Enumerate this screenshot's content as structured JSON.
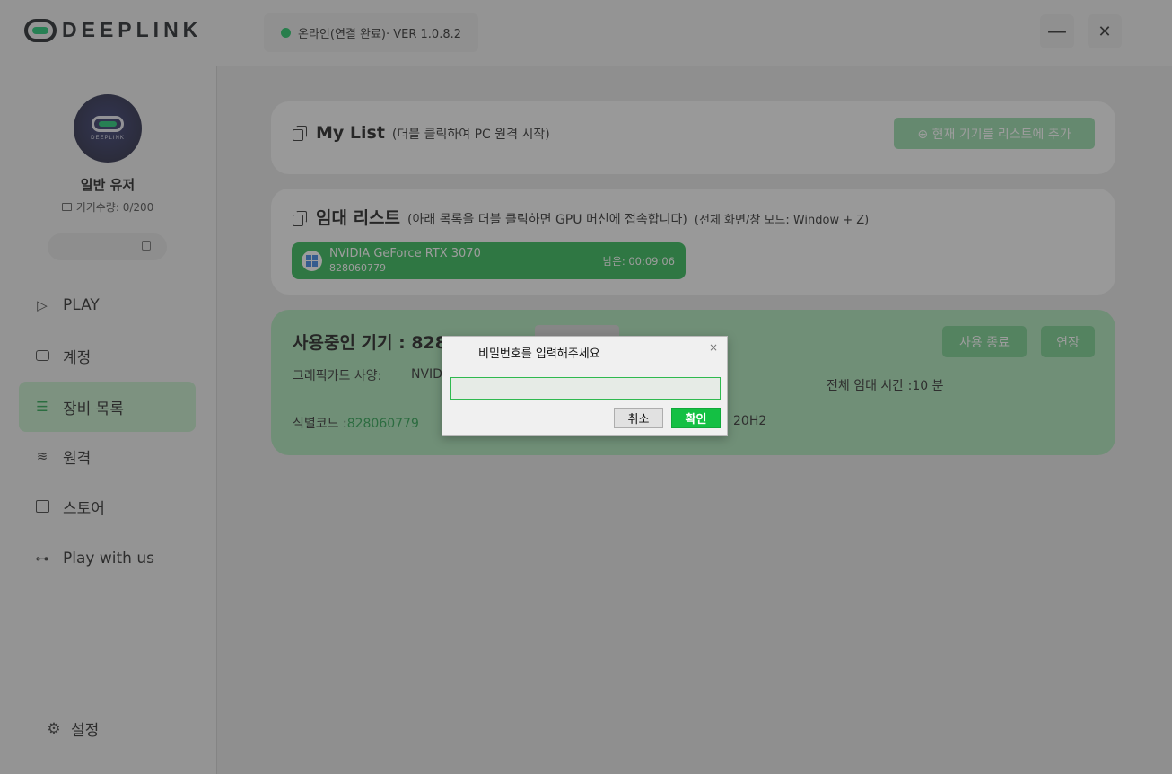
{
  "app": {
    "logo_text": "DEEPLINK",
    "status_text": "온라인(연결 완료)· VER 1.0.8.2",
    "status_color": "#15c15d",
    "minimize_glyph": "—",
    "close_glyph": "✕"
  },
  "sidebar": {
    "avatar_text": "DEEPLINK",
    "user_name": "일반 유저",
    "device_count": "기기수량: 0/200",
    "nav": [
      {
        "label": "PLAY",
        "icon": "play-icon",
        "active": false
      },
      {
        "label": "계정",
        "icon": "wallet-icon",
        "active": false
      },
      {
        "label": "장비 목록",
        "icon": "list-icon",
        "active": true
      },
      {
        "label": "원격",
        "icon": "wifi-icon",
        "active": false
      },
      {
        "label": "스토어",
        "icon": "store-icon",
        "active": false
      },
      {
        "label": "Play with us",
        "icon": "gamepad-icon",
        "active": false
      }
    ],
    "settings_label": "설정"
  },
  "mylist": {
    "title": "My List",
    "subtitle": "(더블 클릭하여 PC 원격 시작)",
    "add_button": "⊕ 현재 기기를 리스트에 추가"
  },
  "rental": {
    "title": "임대 리스트",
    "subtitle": "(아래 목록을 더블 클릭하면 GPU 머신에 접속합니다)",
    "hint": "(전체 화면/창 모드: Window + Z)",
    "items": [
      {
        "gpu": "NVIDIA GeForce RTX 3070",
        "id": "828060779",
        "remaining": "남은: 00:09:06"
      }
    ]
  },
  "in_use": {
    "title": "사용중인 기기 : 828060779",
    "end_button": "사용 종료",
    "extend_button": "연장",
    "spec_label": "그래픽카드 사양:",
    "spec_value": "NVIDIA",
    "total_time": "전체 임대 시간 :10 분",
    "id_label": "식별코드 :",
    "id_value": "828060779",
    "os_value": "20H2"
  },
  "dialog": {
    "title": "비밀번호를 입력해주세요",
    "close_glyph": "×",
    "input_value": "",
    "input_placeholder": "",
    "cancel": "취소",
    "ok": "확인"
  }
}
